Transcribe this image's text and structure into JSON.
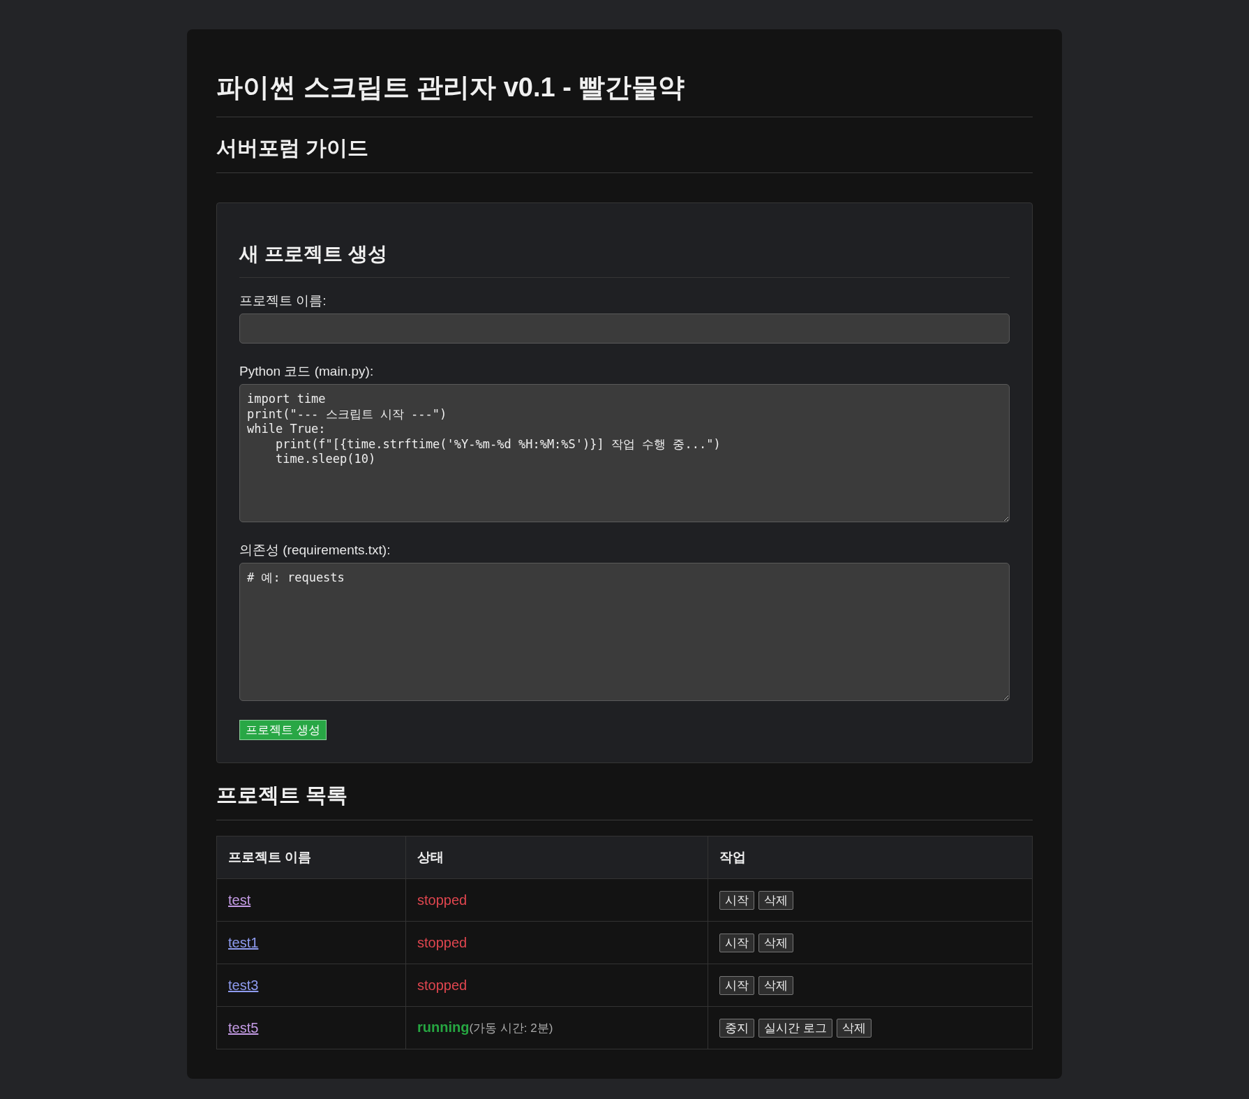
{
  "title": "파이썬 스크립트 관리자 v0.1 - 빨간물약",
  "subtitle": "서버포럼 가이드",
  "form": {
    "heading": "새 프로젝트 생성",
    "fields": [
      {
        "kind": "input",
        "label": "프로젝트 이름:"
      },
      {
        "kind": "textarea",
        "label": "Python 코드 (main.py):",
        "value": "import time\nprint(\"--- 스크립트 시작 ---\")\nwhile True:\n    print(f\"[{time.strftime('%Y-%m-%d %H:%M:%S')}] 작업 수행 중...\")\n    time.sleep(10)"
      },
      {
        "kind": "textarea",
        "label": "의존성 (requirements.txt):",
        "value": "# 예: requests"
      }
    ],
    "submit": "프로젝트 생성"
  },
  "projects": {
    "heading": "프로젝트 목록",
    "columns": [
      "프로젝트 이름",
      "상태",
      "작업"
    ],
    "rows": [
      {
        "name": "test",
        "visited": true,
        "status": "stopped",
        "kind": "stopped",
        "actions": [
          "시작",
          "삭제"
        ]
      },
      {
        "name": "test1",
        "visited": false,
        "status": "stopped",
        "kind": "stopped",
        "actions": [
          "시작",
          "삭제"
        ]
      },
      {
        "name": "test3",
        "visited": false,
        "status": "stopped",
        "kind": "stopped",
        "actions": [
          "시작",
          "삭제"
        ]
      },
      {
        "name": "test5",
        "visited": true,
        "status": "running",
        "kind": "running",
        "uptime": "(가동 시간: 2분)",
        "actions": [
          "중지",
          "실시간 로그",
          "삭제"
        ]
      }
    ]
  }
}
